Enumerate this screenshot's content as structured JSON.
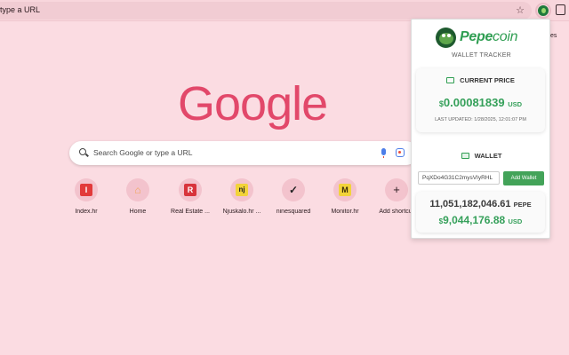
{
  "browser": {
    "omnibox_text": "type a URL",
    "top_right_fragment": "es"
  },
  "ntp": {
    "logo_text": "Google",
    "search_placeholder": "Search Google or type a URL",
    "shortcuts": [
      {
        "label": "Index.hr",
        "glyph": "I",
        "color": "#e23a3a"
      },
      {
        "label": "Home",
        "glyph": "⌂",
        "color": "#f0a75a"
      },
      {
        "label": "Real Estate ...",
        "glyph": "R",
        "color": "#d8343c"
      },
      {
        "label": "Njuskalo.hr ...",
        "glyph": "nj",
        "color": "#f2d33a"
      },
      {
        "label": "ninesquared",
        "glyph": "✓",
        "color": "#222222"
      },
      {
        "label": "Monitor.hr",
        "glyph": "M",
        "color": "#3a2c0a"
      },
      {
        "label": "Add shortcut",
        "glyph": "+",
        "color": "#2a1a1e"
      }
    ]
  },
  "popup": {
    "brand_bold": "Pepe",
    "brand_rest": "coin",
    "subtitle": "WALLET TRACKER",
    "price_title": "CURRENT PRICE",
    "price_dollar": "$",
    "price_value": "0.00081839",
    "price_unit": "USD",
    "last_updated": "LAST UPDATED: 1/28/2025, 12:01:07 PM",
    "wallet_title": "WALLET",
    "wallet_input_value": "PqXDo4G31C2mysVIyRHL",
    "add_wallet_label": "Add Wallet",
    "balance_amount": "11,051,182,046.61",
    "balance_unit": "PEPE",
    "usd_dollar": "$",
    "usd_value": "9,044,176.88",
    "usd_unit": "USD"
  },
  "colors": {
    "page_bg": "#fbdce2",
    "accent_green": "#2f9e52",
    "google_logo": "#e2486a"
  }
}
